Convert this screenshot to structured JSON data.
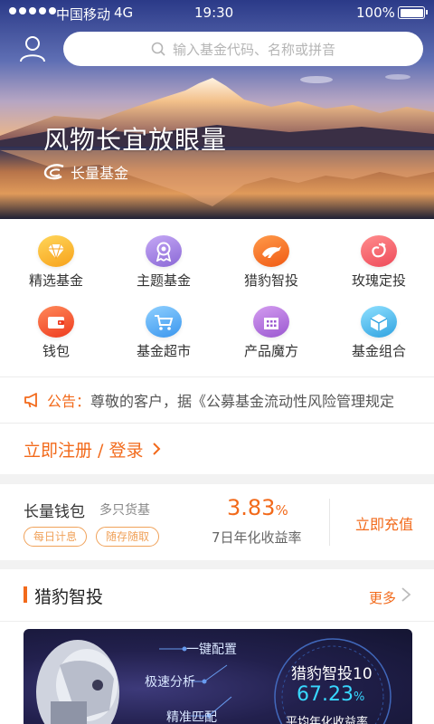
{
  "status_bar": {
    "carrier": "中国移动",
    "network": "4G",
    "time": "19:30",
    "battery": "100%"
  },
  "search": {
    "placeholder": "输入基金代码、名称或拼音",
    "icon": "search-icon"
  },
  "hero": {
    "slogan": "风物长宜放眼量",
    "brand": "长量基金"
  },
  "menu": {
    "items": [
      {
        "label": "精选基金",
        "icon": "diamond-icon",
        "color": "#f7b733"
      },
      {
        "label": "主题基金",
        "icon": "medal-icon",
        "color": "#9b7ee0"
      },
      {
        "label": "猎豹智投",
        "icon": "cheetah-icon",
        "color": "#f26a1b"
      },
      {
        "label": "玫瑰定投",
        "icon": "rose-icon",
        "color": "#f45b6a"
      },
      {
        "label": "钱包",
        "icon": "wallet-icon",
        "color": "#f2542d"
      },
      {
        "label": "基金超市",
        "icon": "cart-icon",
        "color": "#4aa8f2"
      },
      {
        "label": "产品魔方",
        "icon": "building-icon",
        "color": "#b06ad8"
      },
      {
        "label": "基金组合",
        "icon": "cube-icon",
        "color": "#3fb0e8"
      }
    ]
  },
  "notice": {
    "prefix": "公告：",
    "text": "尊敬的客户，据《公募基金流动性风险管理规定"
  },
  "register": {
    "label": "立即注册 / 登录"
  },
  "wallet": {
    "title": "长量钱包",
    "subtitle": "多只货基",
    "tags": [
      "每日计息",
      "随存随取"
    ],
    "rate": "3.83",
    "rate_unit": "%",
    "rate_label": "7日年化收益率",
    "action": "立即充值"
  },
  "robo_section": {
    "title": "猎豹智投",
    "more": "更多",
    "features": [
      "一键配置",
      "极速分析",
      "精准匹配"
    ],
    "product": "猎豹智投10",
    "rate": "67.23",
    "rate_unit": "%",
    "rate_label": "平均年化收益率"
  },
  "colors": {
    "accent": "#f26a1b",
    "tag": "#f0a25a"
  }
}
